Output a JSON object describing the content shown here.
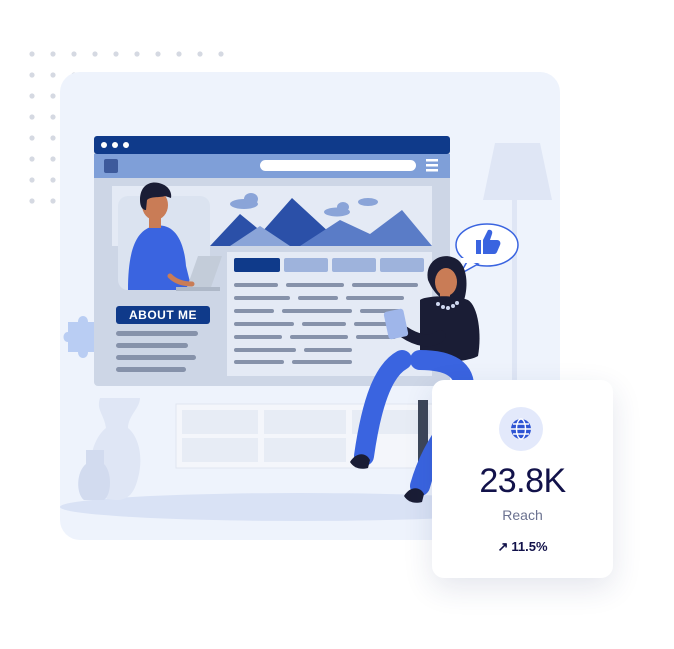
{
  "illustration": {
    "about_me_label": "ABOUT ME"
  },
  "stats_card": {
    "icon": "globe-icon",
    "value": "23.8K",
    "label": "Reach",
    "change_icon": "arrow-up-right-icon",
    "change": "11.5%"
  },
  "colors": {
    "navy": "#0f3a8a",
    "blue": "#3a64e0",
    "panel_bg": "#eef3fc",
    "text_dark": "#12124a"
  }
}
